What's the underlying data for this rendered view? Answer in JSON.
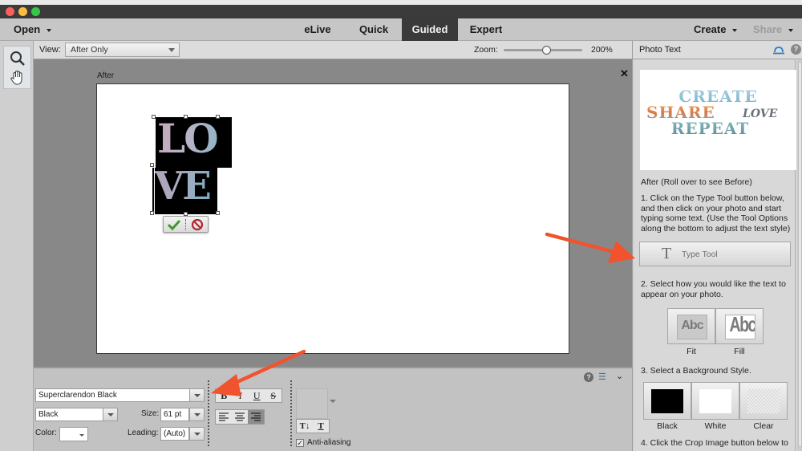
{
  "window": {
    "traffic_lights": [
      "close",
      "minimize",
      "zoom"
    ],
    "colors": {
      "close": "#fc605c",
      "minimize": "#fdbc40",
      "zoom": "#34c84a"
    }
  },
  "topbar": {
    "open_label": "Open",
    "modes": [
      {
        "label": "eLive",
        "active": false
      },
      {
        "label": "Quick",
        "active": false
      },
      {
        "label": "Guided",
        "active": true
      },
      {
        "label": "Expert",
        "active": false
      }
    ],
    "create_label": "Create",
    "share_label": "Share"
  },
  "toolbox": {
    "tools": [
      "zoom-tool",
      "hand-tool"
    ]
  },
  "options": {
    "view_label": "View:",
    "view_value": "After Only",
    "zoom_label": "Zoom:",
    "zoom_value": "200%",
    "zoom_slider_fraction": 0.55
  },
  "canvas": {
    "view_caption": "After",
    "text_line1": "LO",
    "text_line2": "VE"
  },
  "tool_options": {
    "font_family": "Superclarendon Black",
    "font_style": "Black",
    "size_label": "Size:",
    "size_value": "61 pt",
    "color_label": "Color:",
    "leading_label": "Leading:",
    "leading_value": "(Auto)",
    "style_buttons": [
      "B",
      "I",
      "U",
      "S"
    ],
    "align_buttons": [
      "align-left",
      "align-center",
      "align-right"
    ],
    "active_align": "align-right",
    "orientation_buttons": [
      "T↓",
      "T"
    ],
    "anti_aliasing_label": "Anti-aliasing",
    "anti_aliasing_checked": true
  },
  "panel": {
    "title": "Photo Text",
    "preview_words": [
      "CREATE",
      "SHARE",
      "LOVE",
      "REPEAT"
    ],
    "caption": "After (Roll over to see Before)",
    "step1": "1. Click on the Type Tool button below, and then click on your photo and start typing some text. (Use the Tool Options along the bottom to adjust the text style)",
    "type_tool_glyph": "T",
    "type_tool_label": "Type Tool",
    "step2": "2. Select how you would like the text to appear on your photo.",
    "fit_options": [
      {
        "label": "Fit",
        "glyph": "Abc"
      },
      {
        "label": "Fill",
        "glyph": "Abc"
      }
    ],
    "step3": "3. Select a Background Style.",
    "backgrounds": [
      {
        "label": "Black",
        "color": "#000000"
      },
      {
        "label": "White",
        "color": "#ffffff"
      },
      {
        "label": "Clear",
        "color": "transparent"
      }
    ],
    "step4": "4. Click the Crop Image button below to"
  },
  "annotations": {
    "arrow_color": "#f0532d"
  }
}
